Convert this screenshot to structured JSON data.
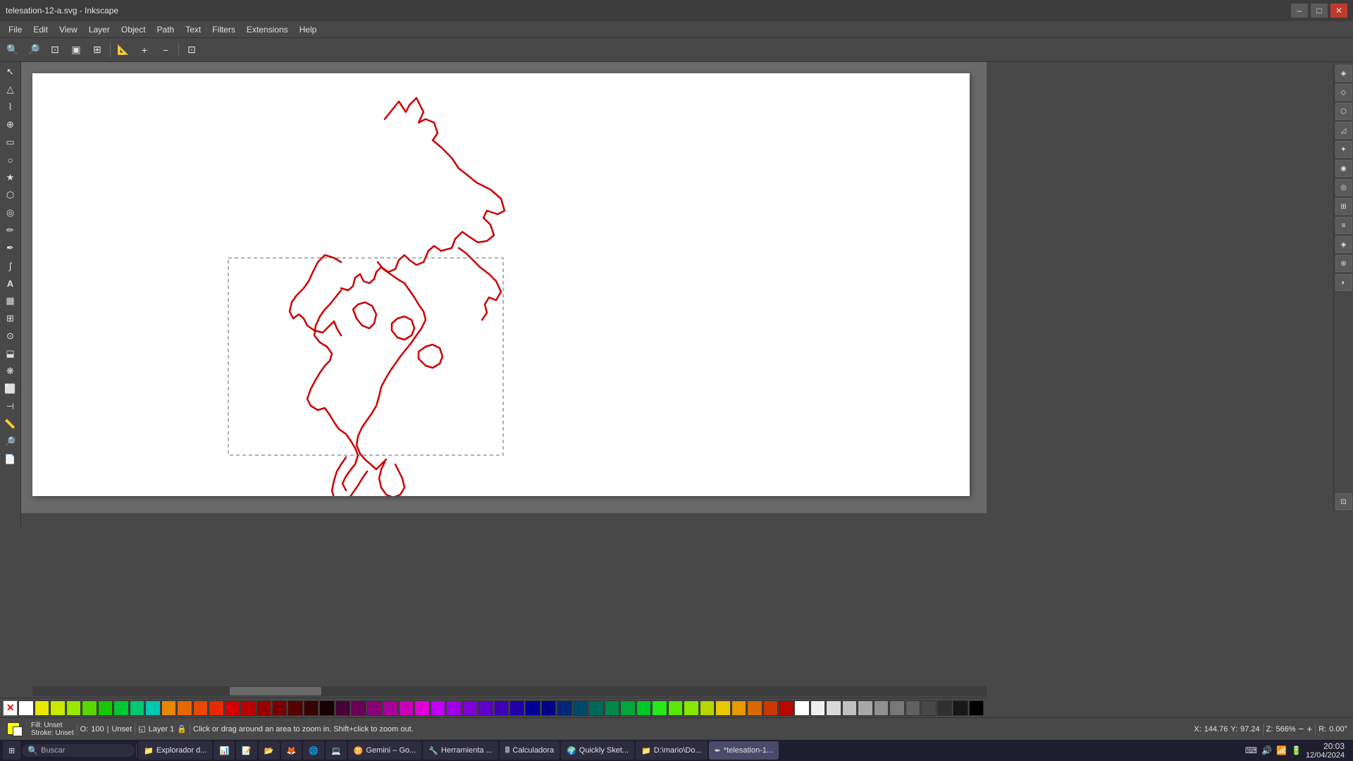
{
  "titlebar": {
    "title": "telesation-12-a.svg - Inkscape",
    "minimize": "–",
    "maximize": "□",
    "close": "✕"
  },
  "menubar": {
    "items": [
      "File",
      "Edit",
      "View",
      "Layer",
      "Object",
      "Path",
      "Text",
      "Filters",
      "Extensions",
      "Help"
    ]
  },
  "toolbar": {
    "tools": [
      "🔍+",
      "🔍-",
      "🔍fit",
      "🔍pg",
      "🔍sel",
      "🔍drw",
      "📐",
      "🔍+z",
      "🔍-z"
    ]
  },
  "toolbox": {
    "tools": [
      {
        "name": "selector",
        "icon": "↖",
        "active": false
      },
      {
        "name": "node-editor",
        "icon": "▲",
        "active": false
      },
      {
        "name": "tweak",
        "icon": "~",
        "active": false
      },
      {
        "name": "zoom",
        "icon": "🔍",
        "active": false
      },
      {
        "name": "rect",
        "icon": "▭",
        "active": false
      },
      {
        "name": "ellipse",
        "icon": "○",
        "active": false
      },
      {
        "name": "star",
        "icon": "★",
        "active": false
      },
      {
        "name": "3d-box",
        "icon": "◻",
        "active": false
      },
      {
        "name": "spiral",
        "icon": "◎",
        "active": false
      },
      {
        "name": "pencil",
        "icon": "✏",
        "active": false
      },
      {
        "name": "pen",
        "icon": "🖊",
        "active": false
      },
      {
        "name": "calligraphy",
        "icon": "✒",
        "active": false
      },
      {
        "name": "text",
        "icon": "A",
        "active": false
      },
      {
        "name": "gradient",
        "icon": "▦",
        "active": false
      },
      {
        "name": "mesh-gradient",
        "icon": "⊞",
        "active": false
      },
      {
        "name": "dropper",
        "icon": "💧",
        "active": false
      },
      {
        "name": "paint-bucket",
        "icon": "🪣",
        "active": false
      },
      {
        "name": "spray",
        "icon": "💨",
        "active": false
      },
      {
        "name": "eraser",
        "icon": "⬜",
        "active": false
      },
      {
        "name": "connector",
        "icon": "⊣",
        "active": false
      },
      {
        "name": "measure",
        "icon": "📏",
        "active": false
      },
      {
        "name": "find",
        "icon": "🔎",
        "active": false
      },
      {
        "name": "pages",
        "icon": "📄",
        "active": false
      }
    ]
  },
  "status": {
    "fill_label": "Fill:",
    "fill_value": "Unset",
    "stroke_label": "Stroke:",
    "stroke_value": "Unset",
    "opacity_label": "O:",
    "opacity_value": "100",
    "layer_label": "Layer 1",
    "message": "Click or drag around an area to zoom in. Shift+click to zoom out.",
    "x_label": "X:",
    "x_value": "144.76",
    "y_label": "Y:",
    "y_value": "97.24",
    "z_label": "Z:",
    "z_value": "566%",
    "r_label": "R:",
    "r_value": "0.00°"
  },
  "palette": {
    "colors": [
      "#ffffff",
      "#000000",
      "#ff0000",
      "#00ff00",
      "#0000ff",
      "#ffff00",
      "#ff00ff",
      "#00ffff",
      "#ff8800",
      "#88ff00",
      "#ff0088",
      "#0088ff",
      "#8800ff",
      "#00ff88",
      "#444444",
      "#888888",
      "#bbbbbb",
      "#dddddd",
      "#cc0000",
      "#cc6600",
      "#cccc00",
      "#00cc00",
      "#0000cc",
      "#6600cc",
      "#cc00cc",
      "#ff9999",
      "#ffcc99",
      "#ffff99",
      "#99ff99",
      "#99ccff",
      "#cc99ff",
      "#ff99cc",
      "#660000",
      "#663300",
      "#666600",
      "#006600",
      "#000066",
      "#330066",
      "#660066",
      "#993300",
      "#996600",
      "#999900",
      "#009900",
      "#000099",
      "#330099",
      "#cc3300",
      "#cc9900",
      "#99cc00",
      "#00cc66",
      "#0066cc",
      "#6600cc",
      "#ff6600",
      "#ffcc00",
      "#99ff00",
      "#00ff66",
      "#0099ff",
      "#6633ff",
      "#ff3300",
      "#ff9900",
      "#ccff00",
      "#00ff33",
      "#0033ff",
      "#9900ff"
    ]
  },
  "taskbar": {
    "start_icon": "⊞",
    "search_placeholder": "Buscar",
    "apps": [
      {
        "name": "file-explorer",
        "icon": "📁",
        "label": "Explorador d..."
      },
      {
        "name": "taskbar-app2",
        "icon": "📊",
        "label": ""
      },
      {
        "name": "taskbar-app3",
        "icon": "📝",
        "label": ""
      },
      {
        "name": "taskbar-app4",
        "icon": "📂",
        "label": ""
      },
      {
        "name": "firefox",
        "icon": "🦊",
        "label": ""
      },
      {
        "name": "browser2",
        "icon": "🌐",
        "label": ""
      },
      {
        "name": "vscode",
        "icon": "💻",
        "label": ""
      },
      {
        "name": "gemini",
        "icon": "♊",
        "label": "Gemini – Go..."
      },
      {
        "name": "tool-app",
        "icon": "🔧",
        "label": "Herramienta ..."
      },
      {
        "name": "calculator",
        "icon": "🖩",
        "label": "Calculadora"
      },
      {
        "name": "browser3",
        "icon": "🌍",
        "label": "Quickly Sket..."
      },
      {
        "name": "explorer2",
        "icon": "📁",
        "label": "D:\\mario\\Do..."
      },
      {
        "name": "inkscape-task",
        "icon": "🖊",
        "label": "*telesation-1..."
      }
    ],
    "tray": {
      "time": "20:03",
      "date": "12/04/2024"
    }
  },
  "right_panel": {
    "icons": [
      "◈",
      "◇",
      "⬡",
      "⊿",
      "✦",
      "◉",
      "◎",
      "⊞",
      "≡",
      "◈",
      "⊛",
      "◐"
    ]
  },
  "drawing": {
    "stroke_color": "#cc0000",
    "stroke_width": 2.5
  }
}
